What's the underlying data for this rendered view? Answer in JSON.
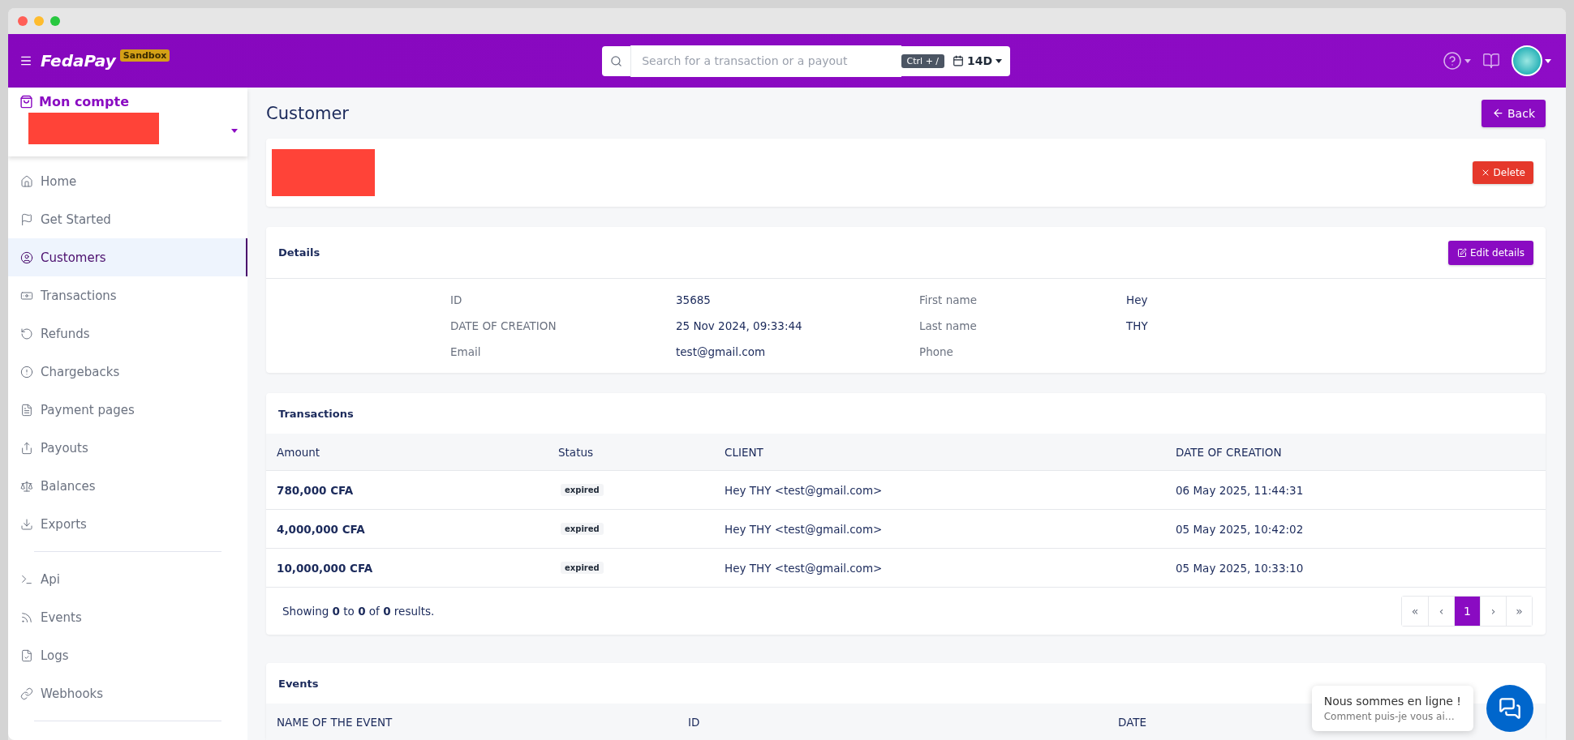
{
  "header": {
    "logo": "FedaPay",
    "env_badge": "Sandbox",
    "search": {
      "placeholder": "Search for a transaction or a payout",
      "shortcut": "Ctrl + /",
      "period": "14D"
    }
  },
  "account": {
    "title": "Mon compte"
  },
  "sidebar": {
    "sections": [
      {
        "items": [
          {
            "label": "Home",
            "selected": false
          },
          {
            "label": "Get Started",
            "selected": false
          },
          {
            "label": "Customers",
            "selected": true
          },
          {
            "label": "Transactions",
            "selected": false
          },
          {
            "label": "Refunds",
            "selected": false
          },
          {
            "label": "Chargebacks",
            "selected": false
          },
          {
            "label": "Payment pages",
            "selected": false
          },
          {
            "label": "Payouts",
            "selected": false
          },
          {
            "label": "Balances",
            "selected": false
          },
          {
            "label": "Exports",
            "selected": false
          }
        ]
      },
      {
        "items": [
          {
            "label": "Api",
            "selected": false
          },
          {
            "label": "Events",
            "selected": false
          },
          {
            "label": "Logs",
            "selected": false
          },
          {
            "label": "Webhooks",
            "selected": false
          }
        ]
      }
    ]
  },
  "page": {
    "title": "Customer",
    "back_button": "Back"
  },
  "customer_card": {
    "delete_button": "Delete"
  },
  "details": {
    "title": "Details",
    "edit_button": "Edit details",
    "columns": [
      {
        "fields": [
          {
            "label": "ID",
            "value": "35685"
          },
          {
            "label": "DATE OF CREATION",
            "value": "25 Nov 2024, 09:33:44"
          },
          {
            "label": "Email",
            "value": "test@gmail.com"
          }
        ]
      },
      {
        "fields": [
          {
            "label": "First name",
            "value": "Hey"
          },
          {
            "label": "Last name",
            "value": "THY"
          },
          {
            "label": "Phone"
          }
        ]
      }
    ]
  },
  "transactions": {
    "title": "Transactions",
    "columns": [
      "Amount",
      "Status",
      "CLIENT",
      "DATE OF CREATION"
    ],
    "rows": [
      {
        "amount": "780,000 CFA",
        "status": "expired",
        "client": "Hey THY <test@gmail.com>",
        "date": "06 May 2025, 11:44:31"
      },
      {
        "amount": "4,000,000 CFA",
        "status": "expired",
        "client": "Hey THY <test@gmail.com>",
        "date": "05 May 2025, 10:42:02"
      },
      {
        "amount": "10,000,000 CFA",
        "status": "expired",
        "client": "Hey THY <test@gmail.com>",
        "date": "05 May 2025, 10:33:10"
      }
    ],
    "summary": "Showing **0** to **0** of **0** results.",
    "pagination": [
      {
        "label": "«",
        "selected": false
      },
      {
        "label": "‹",
        "selected": false
      },
      {
        "label": "1",
        "selected": true
      },
      {
        "label": "›",
        "selected": false
      },
      {
        "label": "»",
        "selected": false
      }
    ]
  },
  "events": {
    "title": "Events",
    "columns": [
      "NAME OF THE EVENT",
      "ID",
      "DATE"
    ]
  },
  "chat": {
    "title": "Nous sommes en ligne !",
    "subtitle": "Comment puis-je vous ai…"
  }
}
